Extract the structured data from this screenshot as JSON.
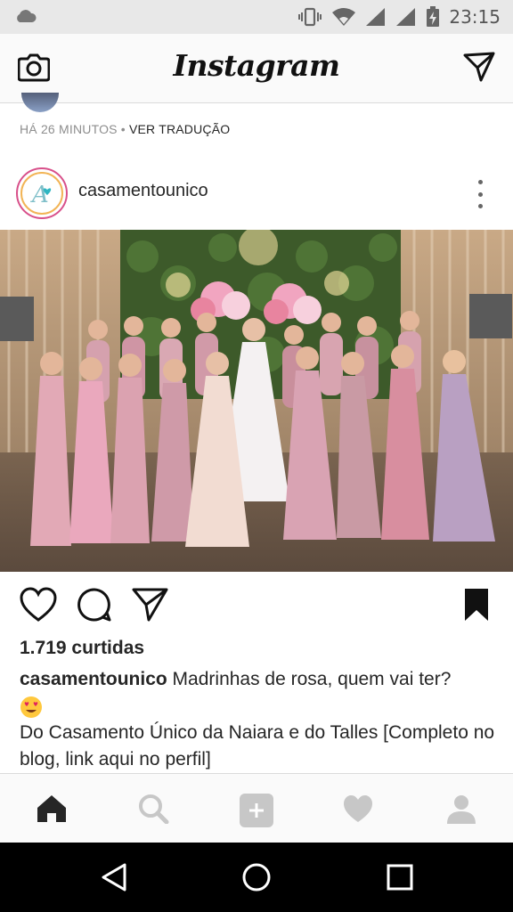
{
  "status_bar": {
    "time": "23:15",
    "icons": [
      "cloud-icon",
      "vibrate-icon",
      "wifi-icon",
      "signal-icon",
      "signal-icon",
      "battery-charging-icon"
    ]
  },
  "header": {
    "logo": "Instagram",
    "left_icon": "camera-icon",
    "right_icon": "direct-message-icon"
  },
  "previous_post": {
    "time_ago": "HÁ 26 MINUTOS",
    "separator": " • ",
    "translate_label": "VER TRADUÇÃO"
  },
  "post": {
    "username": "casamentounico",
    "avatar_monogram": "A",
    "photo_alt": "bridesmaids in pink dresses with bride",
    "actions": [
      "heart-icon",
      "comment-icon",
      "share-icon",
      "bookmark-icon"
    ],
    "likes": "1.719 curtidas",
    "caption_user": "casamentounico",
    "caption_text": " Madrinhas de rosa, quem vai ter?",
    "caption_emoji": "heart-eyes-emoji",
    "caption_line2": "Do Casamento Único da Naiara e do Talles [Completo no blog, link aqui no perfil]"
  },
  "bottom_nav": [
    "home-icon",
    "search-icon",
    "add-post-icon",
    "activity-heart-icon",
    "profile-icon"
  ],
  "android_nav": [
    "back-icon",
    "home-circle-icon",
    "recents-icon"
  ],
  "colors": {
    "text": "#262626",
    "muted": "#8e8e8e",
    "status_bar_bg": "#e8e8e8",
    "header_bg": "#fafafa",
    "nav_active": "#262626",
    "nav_inactive": "#c7c7c7"
  }
}
